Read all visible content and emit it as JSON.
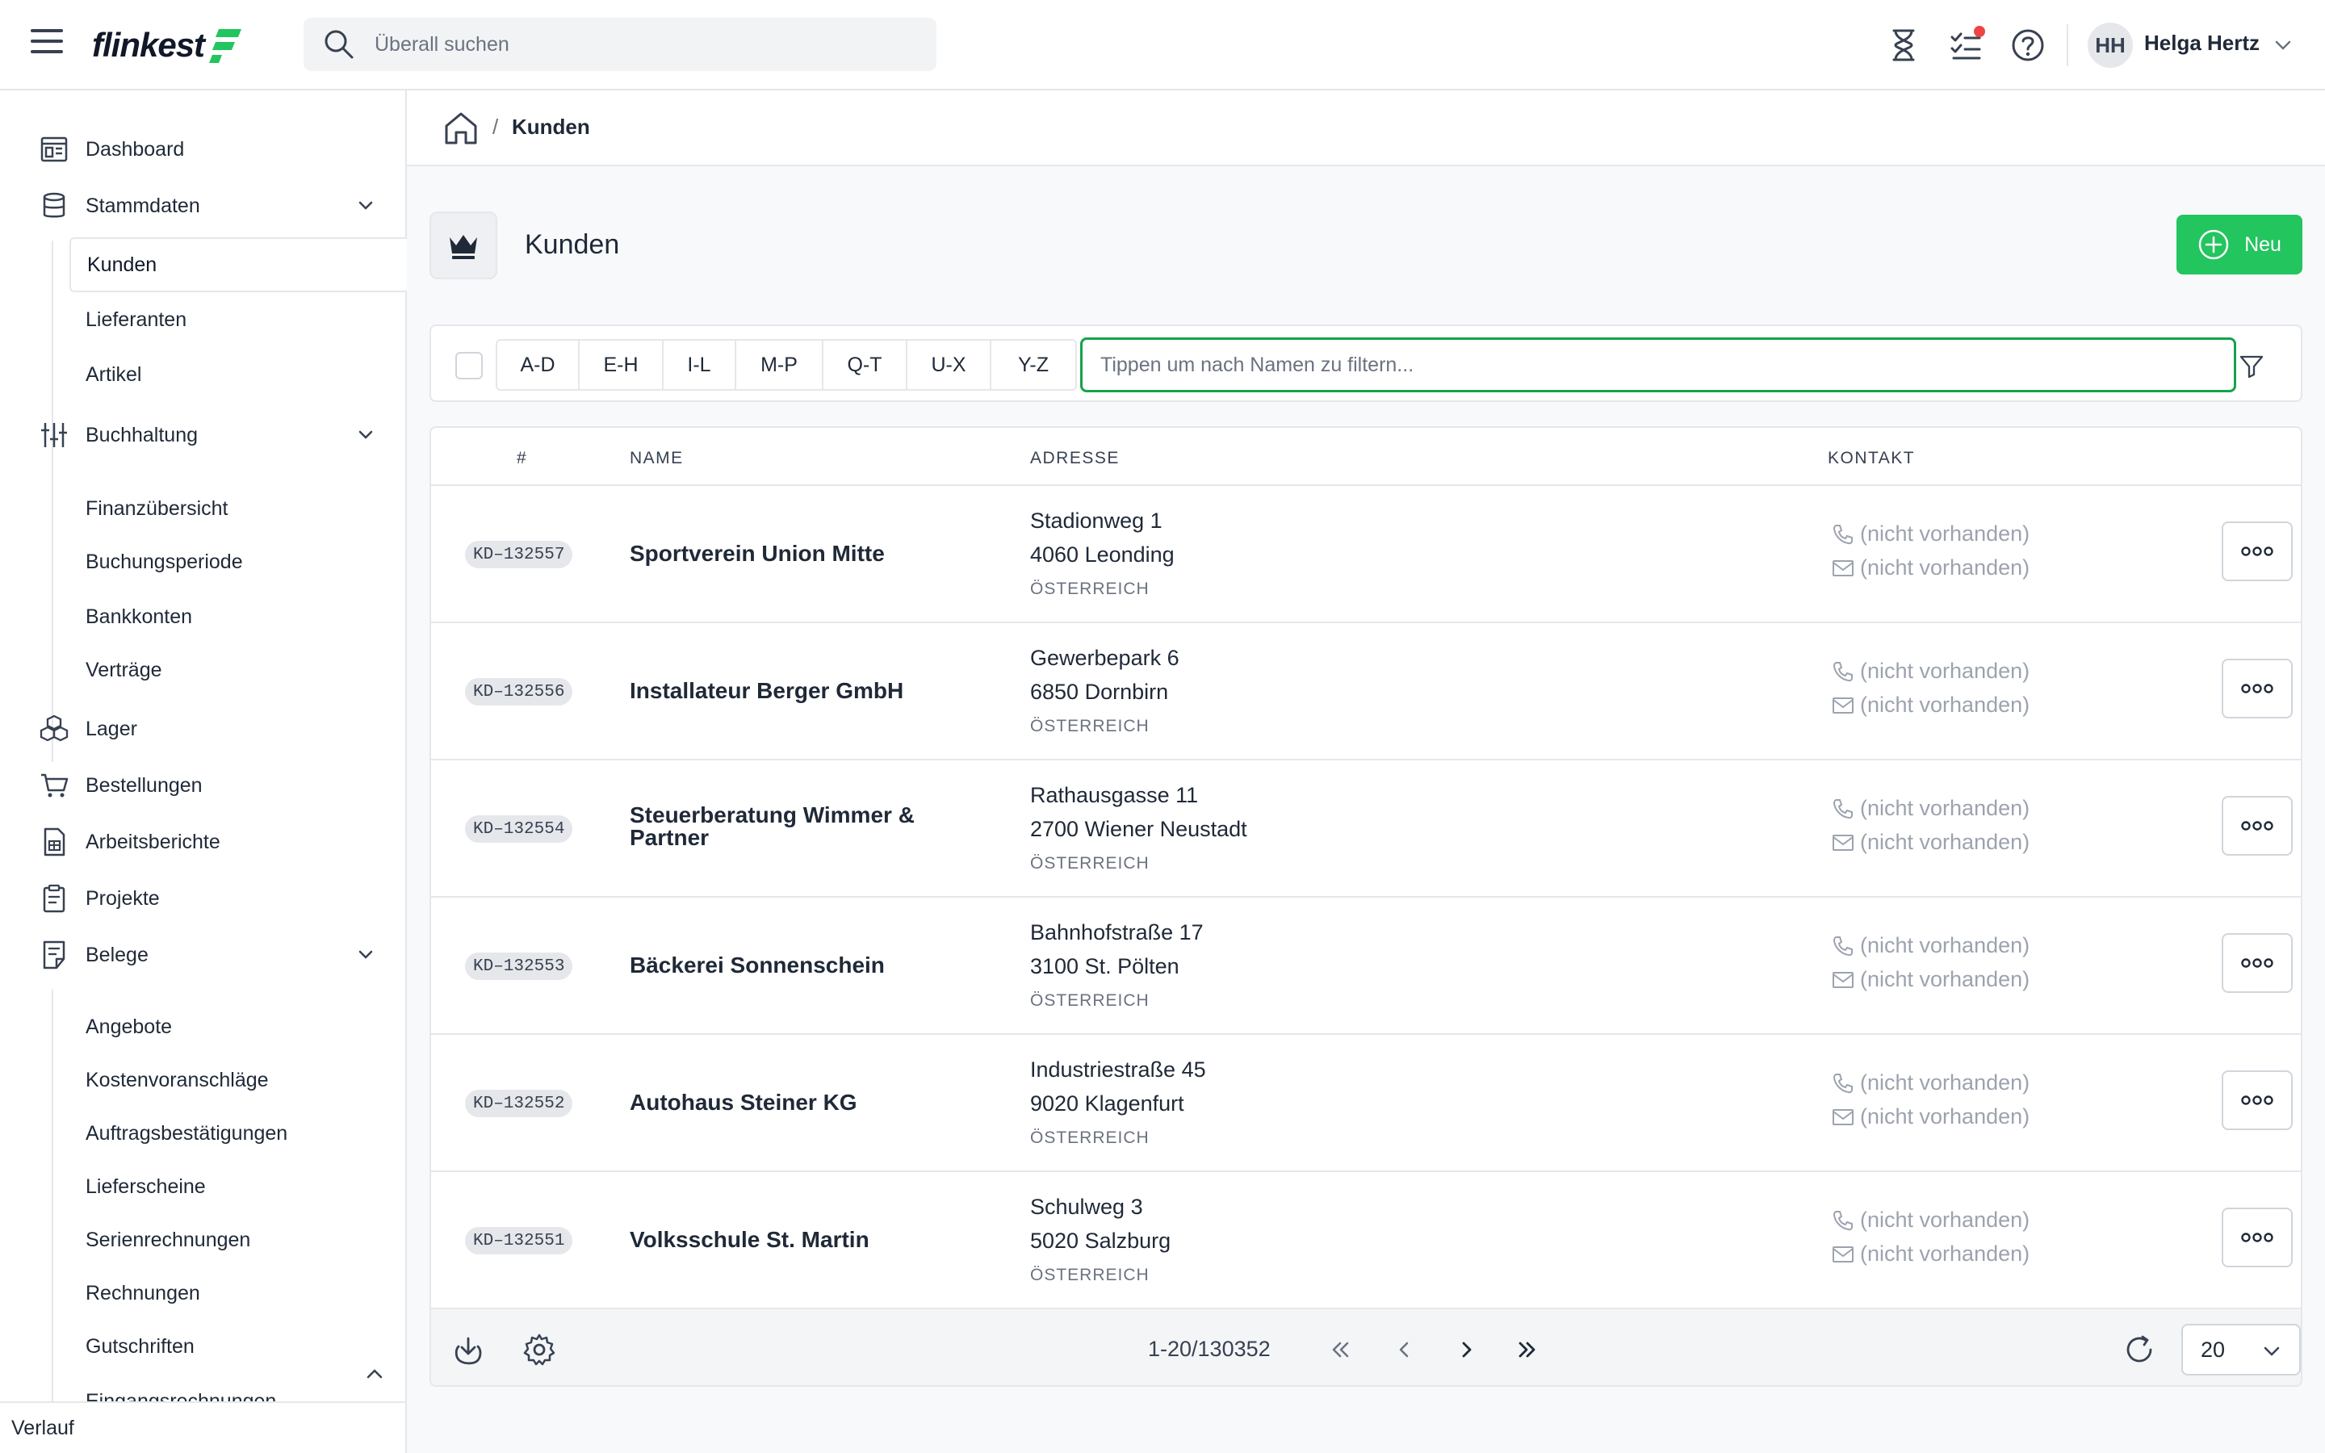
{
  "app": {
    "logo_text": "flinkest",
    "brand_color": "#22c55e"
  },
  "header": {
    "search_placeholder": "Überall suchen",
    "user_initials": "HH",
    "user_name": "Helga Hertz",
    "icons": [
      "hourglass-icon",
      "tasks-icon",
      "help-icon"
    ],
    "notification_dot_color": "#ef4444"
  },
  "sidebar": {
    "items": [
      {
        "label": "Dashboard",
        "icon": "dashboard-icon"
      },
      {
        "label": "Stammdaten",
        "icon": "database-icon",
        "expanded": true,
        "children": [
          "Kunden",
          "Lieferanten",
          "Artikel"
        ]
      },
      {
        "label": "Buchhaltung",
        "icon": "sliders-icon",
        "expanded": true,
        "children": [
          "Finanzübersicht",
          "Buchungsperiode",
          "Bankkonten",
          "Verträge"
        ]
      },
      {
        "label": "Lager",
        "icon": "boxes-icon"
      },
      {
        "label": "Bestellungen",
        "icon": "cart-icon"
      },
      {
        "label": "Arbeitsberichte",
        "icon": "report-icon"
      },
      {
        "label": "Projekte",
        "icon": "clipboard-icon"
      },
      {
        "label": "Belege",
        "icon": "receipt-icon",
        "expanded": true,
        "children": [
          "Angebote",
          "Kostenvoranschläge",
          "Auftragsbestätigungen",
          "Lieferscheine",
          "Serienrechnungen",
          "Rechnungen",
          "Gutschriften",
          "Eingangsrechnungen"
        ]
      }
    ],
    "active_item": "Kunden",
    "footer_label": "Verlauf"
  },
  "breadcrumb": {
    "separator": "/",
    "current": "Kunden"
  },
  "page": {
    "title": "Kunden",
    "new_button_label": "Neu"
  },
  "filter": {
    "letter_groups": [
      "A-D",
      "E-H",
      "I-L",
      "M-P",
      "Q-T",
      "U-X",
      "Y-Z"
    ],
    "name_placeholder": "Tippen um nach Namen zu filtern..."
  },
  "table": {
    "columns": [
      "#",
      "NAME",
      "ADRESSE",
      "KONTAKT"
    ],
    "rows": [
      {
        "id": "KD–132557",
        "name": "Sportverein Union Mitte",
        "street": "Stadionweg 1",
        "city": "4060 Leonding",
        "country": "ÖSTERREICH",
        "phone": "(nicht vorhanden)",
        "email": "(nicht vorhanden)"
      },
      {
        "id": "KD–132556",
        "name": "Installateur Berger GmbH",
        "street": "Gewerbepark 6",
        "city": "6850 Dornbirn",
        "country": "ÖSTERREICH",
        "phone": "(nicht vorhanden)",
        "email": "(nicht vorhanden)"
      },
      {
        "id": "KD–132554",
        "name": "Steuerberatung Wimmer & Partner",
        "street": "Rathausgasse 11",
        "city": "2700 Wiener Neustadt",
        "country": "ÖSTERREICH",
        "phone": "(nicht vorhanden)",
        "email": "(nicht vorhanden)"
      },
      {
        "id": "KD–132553",
        "name": "Bäckerei Sonnenschein",
        "street": "Bahnhofstraße 17",
        "city": "3100 St. Pölten",
        "country": "ÖSTERREICH",
        "phone": "(nicht vorhanden)",
        "email": "(nicht vorhanden)"
      },
      {
        "id": "KD–132552",
        "name": "Autohaus Steiner KG",
        "street": "Industriestraße 45",
        "city": "9020 Klagenfurt",
        "country": "ÖSTERREICH",
        "phone": "(nicht vorhanden)",
        "email": "(nicht vorhanden)"
      },
      {
        "id": "KD–132551",
        "name": "Volksschule St. Martin",
        "street": "Schulweg 3",
        "city": "5020 Salzburg",
        "country": "ÖSTERREICH",
        "phone": "(nicht vorhanden)",
        "email": "(nicht vorhanden)"
      }
    ]
  },
  "pagination": {
    "range_text": "1-20/130352",
    "per_page": "20"
  }
}
